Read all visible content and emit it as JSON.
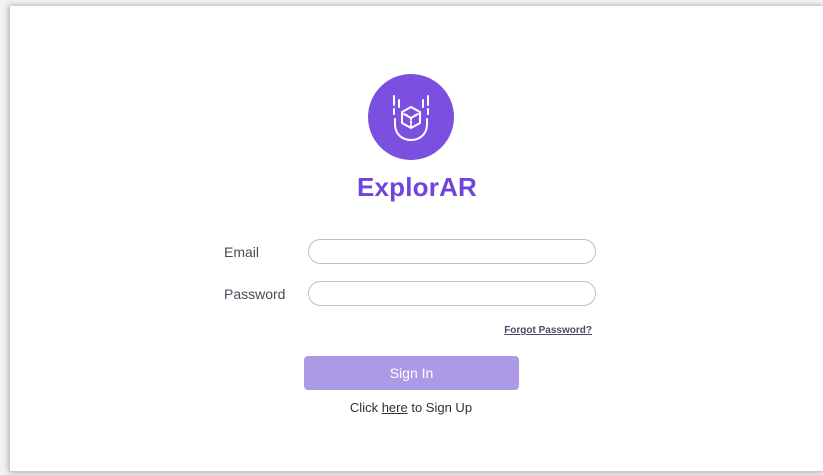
{
  "app": {
    "name": "ExplorAR",
    "logo_icon": "ar-cube-face-icon",
    "accent_color": "#6f45db"
  },
  "form": {
    "email_label": "Email",
    "email_value": "",
    "password_label": "Password",
    "password_value": "",
    "forgot_label": "Forgot Password?",
    "signin_label": "Sign In"
  },
  "signup": {
    "prefix": "Click ",
    "link": "here",
    "suffix": " to Sign Up"
  }
}
